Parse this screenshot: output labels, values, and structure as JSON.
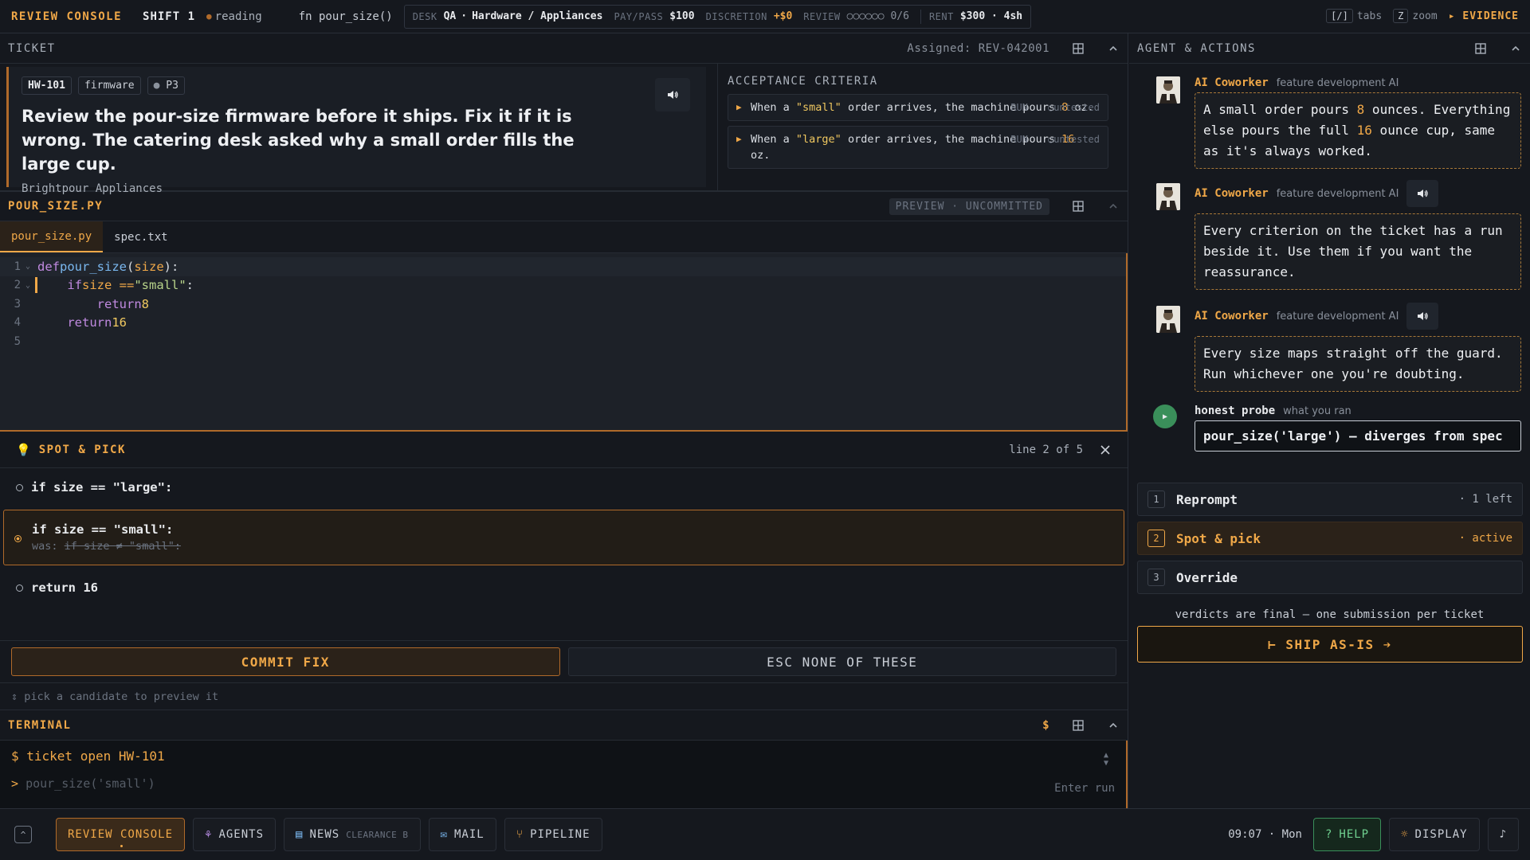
{
  "topbar": {
    "brand": "REVIEW CONSOLE",
    "shift": "SHIFT 1",
    "status": "reading",
    "fn": "fn pour_size()",
    "desk_key": "DESK",
    "desk_val": "QA",
    "dept": "Hardware / Appliances",
    "pay_key": "PAY/PASS",
    "pay_val": "$100",
    "disc_key": "DISCRETION",
    "disc_val": "+$0",
    "review_key": "REVIEW",
    "review_val": "○○○○○○ 0/6",
    "rent_key": "RENT",
    "rent_val": "$300 · 4sh",
    "tabs_key": "[/]",
    "tabs_label": "tabs",
    "zoom_key": "Z",
    "zoom_label": "zoom",
    "evidence": "▸ EVIDENCE"
  },
  "ticket_panel": {
    "title": "TICKET",
    "assigned": "Assigned: REV-042001",
    "id": "HW-101",
    "tag": "firmware",
    "priority": "P3",
    "headline": "Review the pour-size firmware before it ships. Fix it if it is wrong. The catering desk asked why a small order fills the large cup.",
    "company": "Brightpour Appliances",
    "criteria_title": "ACCEPTANCE CRITERIA",
    "criteria": [
      {
        "pre": "When a ",
        "q": "\"small\"",
        "mid": " order arrives, the machine pours ",
        "n": "8",
        "post": " oz.",
        "run": "RUN",
        "status": "○untested"
      },
      {
        "pre": "When a ",
        "q": "\"large\"",
        "mid": " order arrives, the machine pours ",
        "n": "16",
        "post": " oz.",
        "run": "RUN",
        "status": "○untested"
      }
    ]
  },
  "file_panel": {
    "title": "POUR_SIZE.PY",
    "preview": "PREVIEW · UNCOMMITTED",
    "tabs": [
      "pour_size.py",
      "spec.txt"
    ],
    "code": {
      "l1_kw": "def ",
      "l1_fn": "pour_size",
      "l1_p1": "(",
      "l1_arg": "size",
      "l1_p2": "):",
      "l2_kw": "if ",
      "l2_a": "size == ",
      "l2_str": "\"small\"",
      "l2_b": ":",
      "l3_kw": "return ",
      "l3_n": "8",
      "l4_kw": "return ",
      "l4_n": "16",
      "line_numbers": [
        "1",
        "2",
        "3",
        "4",
        "5"
      ]
    }
  },
  "spot": {
    "title": "SPOT & PICK",
    "position": "line 2 of 5",
    "options": [
      {
        "text": "if size == \"large\":"
      },
      {
        "text": "if size == \"small\":",
        "was_label": "was:",
        "was": "if size ≠ \"small\":"
      },
      {
        "text": "return 16"
      }
    ],
    "commit": "COMMIT FIX",
    "esc": "ESC NONE OF THESE",
    "hint": "⇕ pick a candidate to preview it"
  },
  "terminal": {
    "title": "TERMINAL",
    "dollar": "$",
    "cmd": "$ ticket open HW-101",
    "prompt_glyph": ">",
    "placeholder": "pour_size('small')",
    "enter": "Enter run"
  },
  "agent": {
    "title": "AGENT & ACTIONS",
    "messages": [
      {
        "name": "AI Coworker",
        "role": "feature development AI",
        "p1": "A small order pours ",
        "n1": "8",
        "p2": " ounces. Everything else pours the full ",
        "n2": "16",
        "p3": " ounce cup, same as it's always worked."
      },
      {
        "name": "AI Coworker",
        "role": "feature development AI",
        "text": "Every criterion on the ticket has a run beside it. Use them if you want the reassurance."
      },
      {
        "name": "AI Coworker",
        "role": "feature development AI",
        "text": "Every size maps straight off the guard. Run whichever one you're doubting."
      }
    ],
    "probe": {
      "name": "honest probe",
      "role": "what you ran",
      "result": "pour_size('large') — diverges from spec"
    },
    "modes": [
      {
        "num": "1",
        "label": "Reprompt",
        "sub": "· 1 left"
      },
      {
        "num": "2",
        "label": "Spot & pick",
        "sub": "· active"
      },
      {
        "num": "3",
        "label": "Override",
        "sub": ""
      }
    ],
    "final_note": "verdicts are final — one submission per ticket",
    "ship": "⊢ SHIP AS-IS ➔"
  },
  "bottombar": {
    "review": "REVIEW CONSOLE",
    "agents": "AGENTS",
    "news": "NEWS",
    "news_sub": "CLEARANCE B",
    "mail": "MAIL",
    "pipeline": "PIPELINE",
    "clock": "09:07 · Mon",
    "help": "HELP",
    "display": "DISPLAY"
  },
  "colors": {
    "accent": "#f0a848",
    "background": "#15181e",
    "help_green": "#6fd08f"
  },
  "icons": [
    "grid-icon",
    "chevron-up-icon",
    "speaker-icon",
    "bulb-icon",
    "close-icon",
    "play-icon",
    "agents-icon",
    "news-icon",
    "mail-icon",
    "pipeline-icon",
    "help-icon",
    "sun-icon",
    "music-icon",
    "expand-icon"
  ]
}
